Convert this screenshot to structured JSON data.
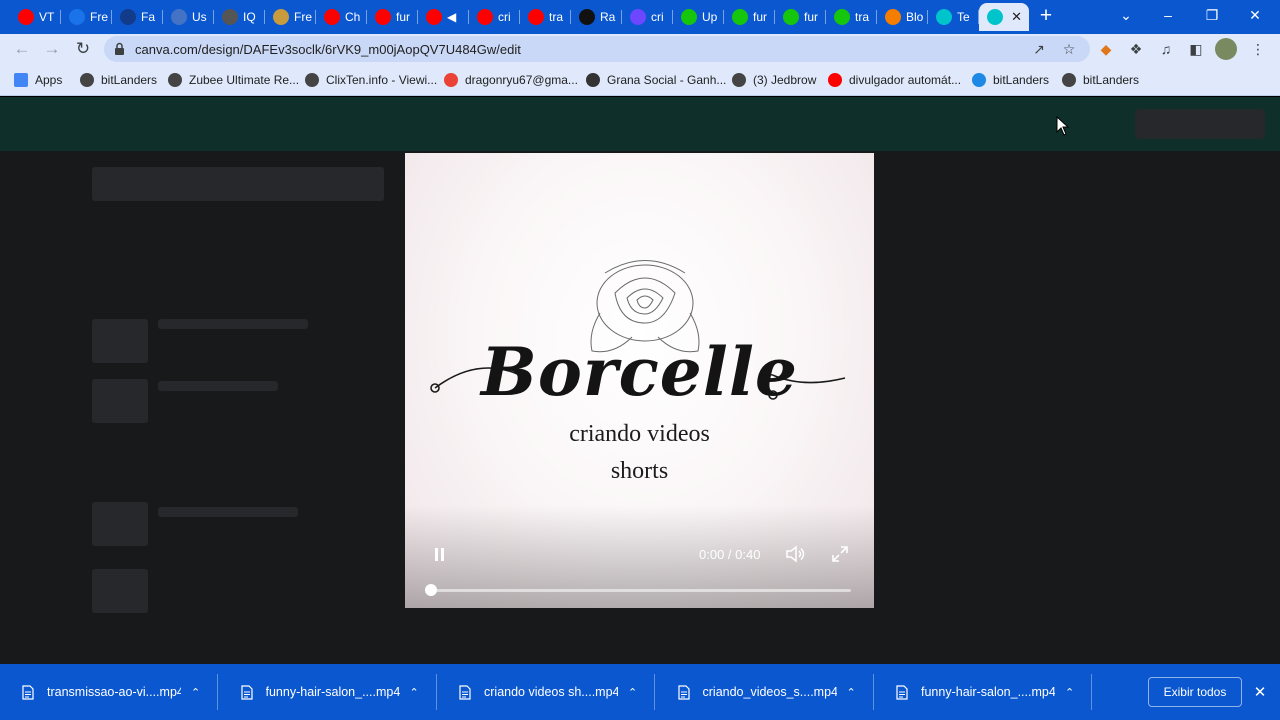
{
  "tabs": [
    {
      "title": "VT",
      "icon": "youtube-icon",
      "color": "#ff0000"
    },
    {
      "title": "Fre",
      "icon": "drop-icon",
      "color": "#1a73e8"
    },
    {
      "title": "Fa",
      "icon": "p-icon",
      "color": "#123b8a"
    },
    {
      "title": "Us",
      "icon": "document-icon",
      "color": "#4472c4"
    },
    {
      "title": "IQ",
      "icon": "globe-icon",
      "color": "#555555"
    },
    {
      "title": "Fre",
      "icon": "image-icon",
      "color": "#c89b3c"
    },
    {
      "title": "Ch",
      "icon": "youtube-icon",
      "color": "#ff0000"
    },
    {
      "title": "fur",
      "icon": "youtube-icon",
      "color": "#ff0000"
    },
    {
      "title": "◀",
      "icon": "youtube-icon",
      "color": "#ff0000"
    },
    {
      "title": "cri",
      "icon": "youtube-icon",
      "color": "#ff0000"
    },
    {
      "title": "tra",
      "icon": "youtube-icon",
      "color": "#ff0000"
    },
    {
      "title": "Ra",
      "icon": "r-icon",
      "color": "#111111"
    },
    {
      "title": "cri",
      "icon": "diamond-icon",
      "color": "#6c47ff"
    },
    {
      "title": "Up",
      "icon": "play-circle-icon",
      "color": "#16c60c"
    },
    {
      "title": "fur",
      "icon": "play-circle-icon",
      "color": "#16c60c"
    },
    {
      "title": "fur",
      "icon": "play-circle-icon",
      "color": "#16c60c"
    },
    {
      "title": "tra",
      "icon": "play-circle-icon",
      "color": "#16c60c"
    },
    {
      "title": "Blo",
      "icon": "blogger-icon",
      "color": "#f57d00"
    },
    {
      "title": "Te",
      "icon": "canva-icon",
      "color": "#00c4cc"
    },
    {
      "title": "",
      "icon": "canva-icon",
      "color": "#00c4cc",
      "active": true
    }
  ],
  "window": {
    "minimize": "–",
    "maximize": "❐",
    "close": "✕",
    "new_tab": "+",
    "tab_search": "⌄"
  },
  "omnibox": {
    "url": "canva.com/design/DAFEv3soclk/6rVK9_m00jAopQV7U484Gw/edit"
  },
  "bookmarks": [
    {
      "label": "Apps",
      "icon": "apps-grid-icon",
      "color": "#4285f4"
    },
    {
      "label": "bitLanders",
      "icon": "globe-icon",
      "color": "#444444"
    },
    {
      "label": "Zubee Ultimate Re...",
      "icon": "globe-icon",
      "color": "#444444"
    },
    {
      "label": "ClixTen.info - Viewi...",
      "icon": "globe-icon",
      "color": "#444444"
    },
    {
      "label": "dragonryu67@gma...",
      "icon": "google-icon",
      "color": "#ea4335"
    },
    {
      "label": "Grana Social - Ganh...",
      "icon": "gs-icon",
      "color": "#333333"
    },
    {
      "label": "(3) Jedbrow",
      "icon": "globe-icon",
      "color": "#444444"
    },
    {
      "label": "divulgador automát...",
      "icon": "youtube-icon",
      "color": "#ff0000"
    },
    {
      "label": "bitLanders",
      "icon": "bitlanders-icon",
      "color": "#1e88e5"
    },
    {
      "label": "bitLanders",
      "icon": "globe-icon",
      "color": "#444444"
    }
  ],
  "video": {
    "brand": "Borcelle",
    "line1": "criando videos",
    "line2": "shorts",
    "time": "0:00 / 0:40",
    "progress": 0.0
  },
  "downloads": [
    {
      "name": "transmissao-ao-vi....mp4"
    },
    {
      "name": "funny-hair-salon_....mp4"
    },
    {
      "name": "criando videos sh....mp4"
    },
    {
      "name": "criando_videos_s....mp4"
    },
    {
      "name": "funny-hair-salon_....mp4"
    }
  ],
  "download_bar": {
    "show_all": "Exibir todos",
    "close": "✕"
  }
}
